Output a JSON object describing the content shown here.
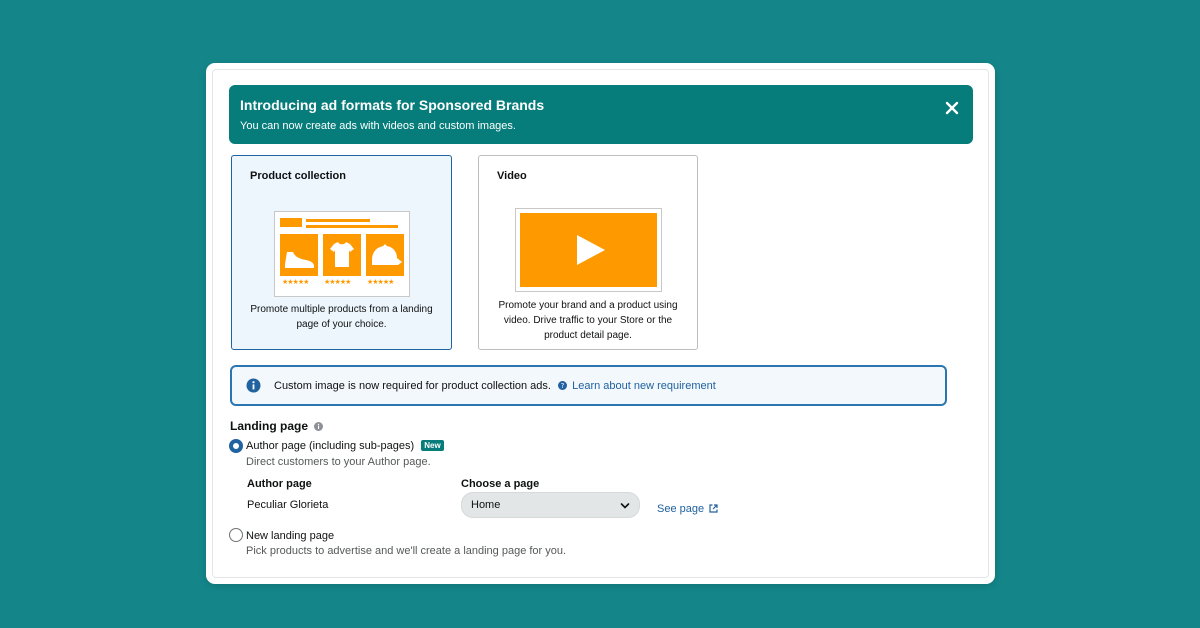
{
  "banner": {
    "title": "Introducing ad formats for Sponsored Brands",
    "subtitle": "You can now create ads with videos and custom images.",
    "close_icon": "close-icon"
  },
  "ad_formats": [
    {
      "title": "Product collection",
      "description": "Promote multiple products from a landing page of your choice.",
      "selected": true,
      "icons": [
        "shoe-icon",
        "tshirt-icon",
        "cap-icon"
      ],
      "stars": [
        "★★★★★",
        "★★★★★",
        "★★★★★"
      ]
    },
    {
      "title": "Video",
      "description": "Promote your brand and a product using video. Drive traffic to your Store or the product detail page.",
      "selected": false,
      "icon": "play-icon"
    }
  ],
  "info_notice": {
    "text": "Custom image is now required for product collection ads.",
    "link": "Learn about new requirement"
  },
  "landing_page": {
    "label": "Landing page",
    "options": [
      {
        "label": "Author page (including sub-pages)",
        "badge": "New",
        "description": "Direct customers to your Author page.",
        "checked": true
      },
      {
        "label": "New landing page",
        "description": "Pick products to advertise and we'll create a landing page for you.",
        "checked": false
      }
    ],
    "author_page_label": "Author page",
    "author_page_value": "Peculiar Glorieta",
    "choose_page_label": "Choose a page",
    "choose_page_value": "Home",
    "see_page_link": "See page"
  },
  "colors": {
    "background": "#14868a",
    "banner": "#067d7a",
    "accent_orange": "#ff9900",
    "link_blue": "#2162a1"
  }
}
